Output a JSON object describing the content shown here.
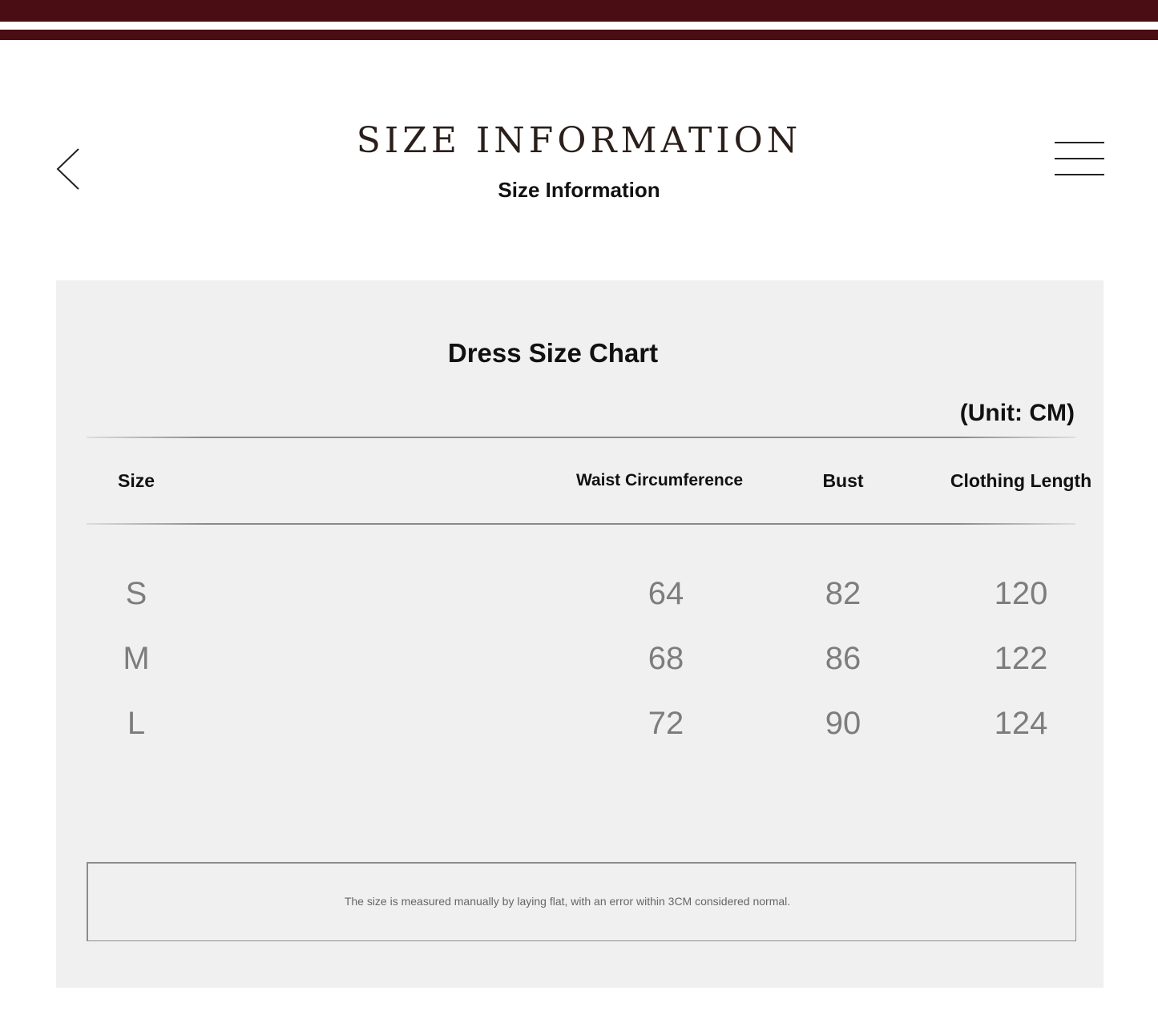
{
  "header": {
    "title": "SIZE INFORMATION",
    "subtitle": "Size Information",
    "back_icon": "chevron-left-icon",
    "menu_icon": "hamburger-menu-icon",
    "accent_color": "#4a0d14"
  },
  "chart": {
    "title": "Dress Size Chart",
    "unit": "(Unit: CM)",
    "columns": [
      "Size",
      "Waist Circumference",
      "Bust",
      "Clothing Length"
    ],
    "rows": [
      [
        "S",
        "64",
        "82",
        "120"
      ],
      [
        "M",
        "68",
        "86",
        "122"
      ],
      [
        "L",
        "72",
        "90",
        "124"
      ]
    ]
  },
  "note": "The size is measured manually by laying flat, with an error within 3CM considered normal."
}
